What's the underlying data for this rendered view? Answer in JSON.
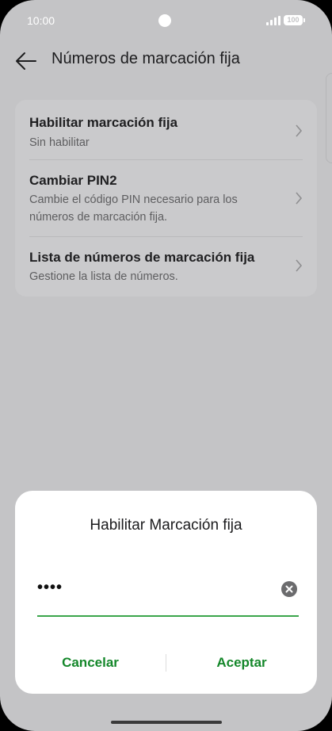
{
  "status_bar": {
    "time": "10:00",
    "battery": "100"
  },
  "header": {
    "title": "Números de marcación fija"
  },
  "settings": {
    "items": [
      {
        "title": "Habilitar marcación fija",
        "subtitle": "Sin habilitar"
      },
      {
        "title": "Cambiar PIN2",
        "subtitle": "Cambie el código PIN necesario para los números de marcación fija."
      },
      {
        "title": "Lista de números de marcación fija",
        "subtitle": "Gestione la lista de números."
      }
    ]
  },
  "dialog": {
    "title": "Habilitar Marcación fija",
    "pin_value": "••••",
    "cancel_label": "Cancelar",
    "ok_label": "Aceptar"
  },
  "colors": {
    "accent": "#14872a",
    "underline": "#3aa54a",
    "background": "#c4c4c6"
  }
}
